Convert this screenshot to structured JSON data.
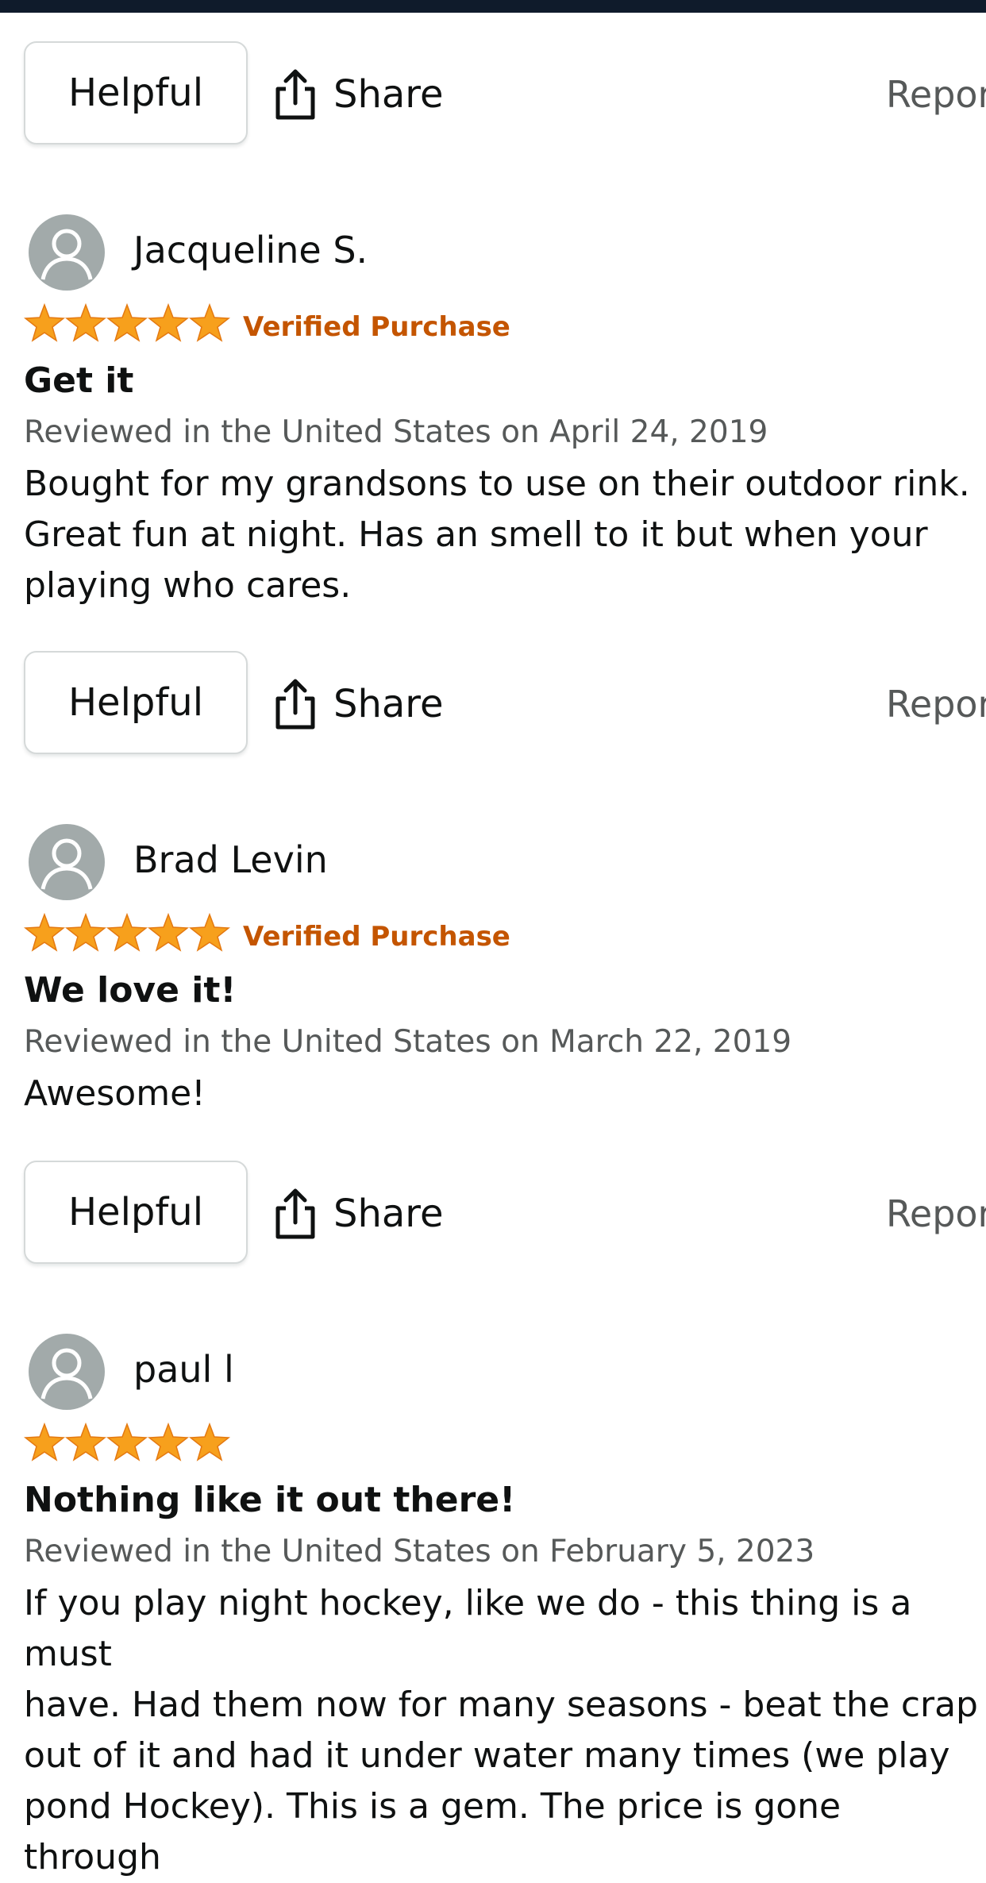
{
  "action_bar": {
    "helpful_label": "Helpful",
    "share_label": "Share",
    "report_label": "Report"
  },
  "reviews": [
    {
      "author": "Jacqueline S.",
      "rating": 5,
      "verified_label": "Verified Purchase",
      "title": "Get it",
      "date": "Reviewed in the United States on April 24, 2019",
      "body": "Bought for my grandsons to use on their outdoor rink.\nGreat fun at night. Has an smell to it but when your\nplaying who cares."
    },
    {
      "author": "Brad Levin",
      "rating": 5,
      "verified_label": "Verified Purchase",
      "title": "We love it!",
      "date": "Reviewed in the United States on March 22, 2019",
      "body": "Awesome!"
    },
    {
      "author": "paul l",
      "rating": 5,
      "verified_label": "",
      "title": "Nothing like it out there!",
      "date": "Reviewed in the United States on February 5, 2023",
      "body": "If you play night hockey, like we do - this thing is a must\nhave. Had them now for many seasons - beat the crap\nout of it and had it under water many times (we play\npond Hockey). This is a gem. The price is gone through"
    }
  ],
  "colors": {
    "star": "#f7a01c",
    "verified": "#c45500",
    "muted_text": "#565959",
    "avatar": "#a2aaaa",
    "top_bar": "#0f1b2b"
  }
}
